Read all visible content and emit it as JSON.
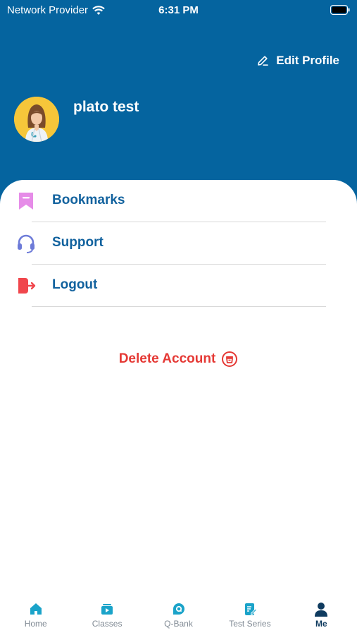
{
  "status_bar": {
    "carrier": "Network Provider",
    "time": "6:31 PM"
  },
  "header": {
    "edit_label": "Edit Profile",
    "user_name": "plato test"
  },
  "menu": {
    "items": [
      {
        "label": "Bookmarks",
        "icon": "bookmark-icon",
        "color": "#e68ce8"
      },
      {
        "label": "Support",
        "icon": "headset-icon",
        "color": "#6d7bd8"
      },
      {
        "label": "Logout",
        "icon": "logout-icon",
        "color": "#f0464c"
      }
    ]
  },
  "delete_account": {
    "label": "Delete Account"
  },
  "tabbar": {
    "tabs": [
      {
        "label": "Home",
        "icon": "home-icon",
        "active": false
      },
      {
        "label": "Classes",
        "icon": "classes-icon",
        "active": false
      },
      {
        "label": "Q-Bank",
        "icon": "qbank-icon",
        "active": false
      },
      {
        "label": "Test Series",
        "icon": "test-series-icon",
        "active": false
      },
      {
        "label": "Me",
        "icon": "person-icon",
        "active": true
      }
    ]
  },
  "colors": {
    "header_bg": "#05649f",
    "accent_text": "#12629e",
    "danger": "#e53935",
    "tab_icon": "#1aa3c9",
    "tab_active": "#0f3b5f"
  }
}
